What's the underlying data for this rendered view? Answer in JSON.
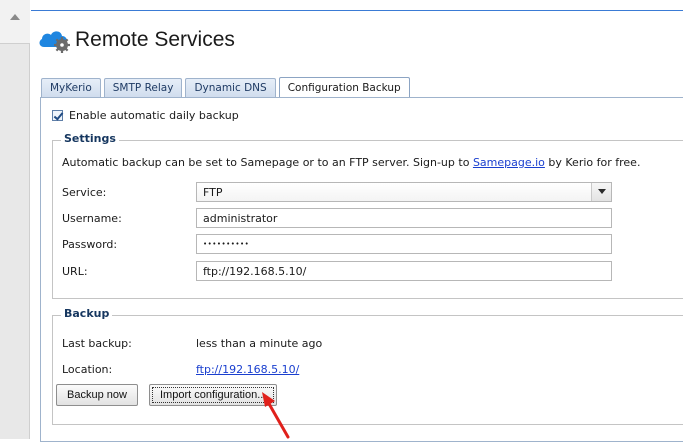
{
  "page": {
    "title": "Remote Services"
  },
  "tabs": [
    {
      "label": "MyKerio"
    },
    {
      "label": "SMTP Relay"
    },
    {
      "label": "Dynamic DNS"
    },
    {
      "label": "Configuration Backup",
      "active": true
    }
  ],
  "auto_backup": {
    "label": "Enable automatic daily backup",
    "checked": true
  },
  "settings": {
    "legend": "Settings",
    "description_before": "Automatic backup can be set to Samepage or to an FTP server. Sign-up to ",
    "description_link": "Samepage.io",
    "description_after": " by Kerio for free.",
    "service_label": "Service:",
    "service_value": "FTP",
    "username_label": "Username:",
    "username_value": "administrator",
    "password_label": "Password:",
    "password_value": "••••••••••",
    "url_label": "URL:",
    "url_value": "ftp://192.168.5.10/"
  },
  "backup": {
    "legend": "Backup",
    "last_backup_label": "Last backup:",
    "last_backup_value": "less than a minute ago",
    "location_label": "Location:",
    "location_value": "ftp://192.168.5.10/",
    "backup_now_label": "Backup now",
    "import_label": "Import configuration..."
  },
  "colors": {
    "tab_border": "#9fb3cc",
    "legend_text": "#15365f",
    "link": "#1a3fcf",
    "annotation_arrow": "#e0201b"
  }
}
